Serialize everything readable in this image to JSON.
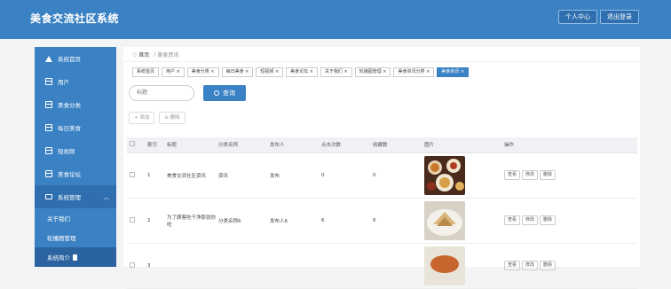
{
  "header": {
    "title": "美食交流社区系统",
    "personal_center": "个人中心",
    "logout": "退出登录"
  },
  "sidebar": {
    "items": [
      {
        "label": "系统首页",
        "icon": "home-icon"
      },
      {
        "label": "用户",
        "icon": "grid-icon"
      },
      {
        "label": "美食分类",
        "icon": "grid-icon"
      },
      {
        "label": "每日美食",
        "icon": "grid-icon"
      },
      {
        "label": "短视频",
        "icon": "grid-icon"
      },
      {
        "label": "美食论坛",
        "icon": "grid-icon"
      },
      {
        "label": "系统管理",
        "icon": "monitor-icon"
      }
    ],
    "sub_items": [
      "关于我们",
      "轮播图管理",
      "系统简介"
    ]
  },
  "breadcrumb": {
    "home": "首页",
    "current": "美食资讯"
  },
  "tabs": [
    "系统首页",
    "用户 ×",
    "美食分类 ×",
    "每日美食 ×",
    "短视频 ×",
    "美食论坛 ×",
    "关于我们 ×",
    "轮播图管理 ×",
    "美食资讯分类 ×",
    "美食资讯 ×"
  ],
  "search": {
    "placeholder": "标题",
    "query_label": "查询"
  },
  "actions": {
    "add": "+ 添加",
    "delete": "⊖ 删除"
  },
  "table": {
    "columns": [
      "",
      "索引",
      "标题",
      "分类名称",
      "发布人",
      "点击次数",
      "收藏数",
      "图片",
      "操作"
    ],
    "rows": [
      {
        "index": "1",
        "title": "美食交流社区资讯",
        "category": "资讯",
        "publisher": "发布",
        "clicks": "0",
        "favorites": "0"
      },
      {
        "index": "2",
        "title": "为了顾客吃干净那就你吃",
        "category": "分类名称6",
        "publisher": "发布人6",
        "clicks": "6",
        "favorites": "6"
      },
      {
        "index": "3",
        "title": "",
        "category": "",
        "publisher": "",
        "clicks": "",
        "favorites": ""
      }
    ],
    "op_view": "查看",
    "op_edit": "修改",
    "op_delete": "删除"
  }
}
